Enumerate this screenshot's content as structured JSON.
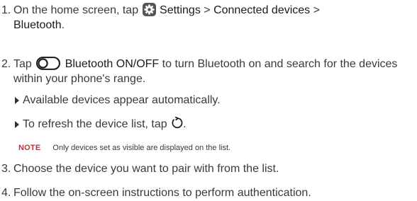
{
  "steps": [
    {
      "num": "1.",
      "pre": "On the home screen, tap",
      "settings": "Settings",
      "sep1": ">",
      "connected": "Connected devices",
      "sep2": ">",
      "bluetooth": "Bluetooth",
      "end": ".",
      "icon": "settings-gear-icon"
    },
    {
      "num": "2.",
      "pre": "Tap",
      "bold": "Bluetooth ON/OFF",
      "post": "to turn Bluetooth on and search for the devices within your phone's range.",
      "icon": "toggle-switch-icon"
    },
    {
      "num": "3.",
      "text": "Choose the device you want to pair with from the list."
    },
    {
      "num": "4.",
      "text": "Follow the on-screen instructions to perform authentication."
    }
  ],
  "bullets": [
    {
      "text": "Available devices appear automatically."
    },
    {
      "pre": "To refresh the device list, tap",
      "end": ".",
      "icon": "refresh-icon"
    }
  ],
  "note": {
    "label": "NOTE",
    "text": "Only devices set as visible are displayed on the list."
  },
  "colors": {
    "text": "#3a3a3a",
    "note_label": "#c0303a",
    "gear_icon_bg": "#555555"
  }
}
